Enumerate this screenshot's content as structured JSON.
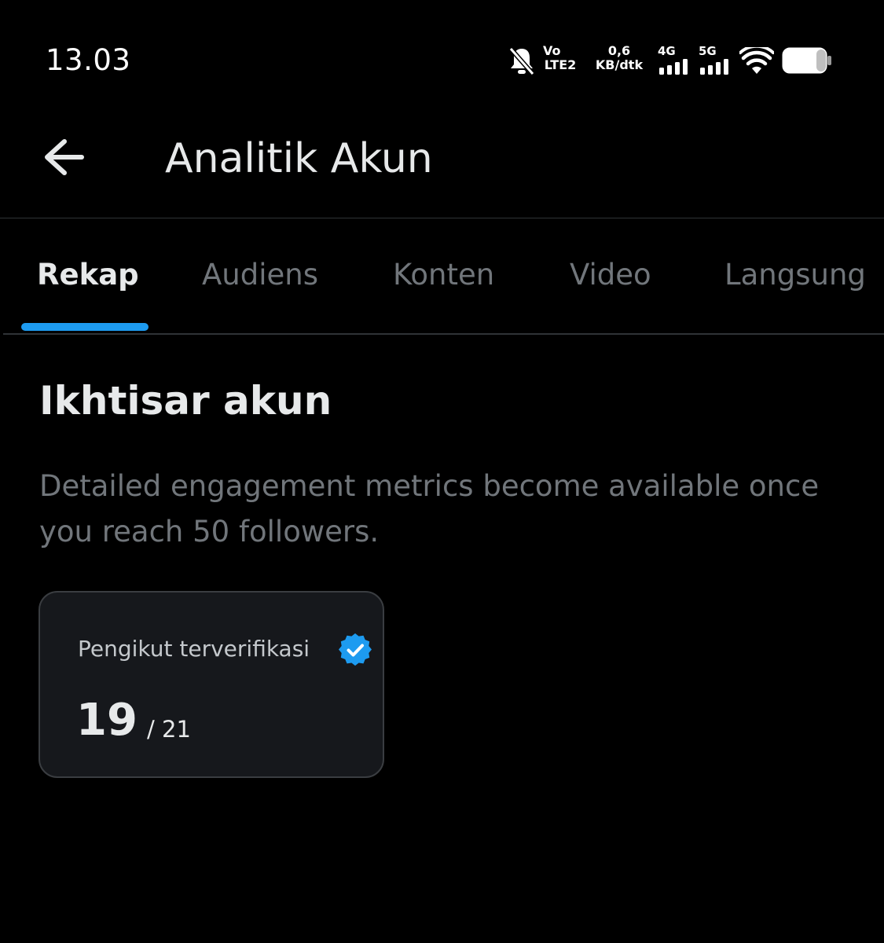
{
  "status_bar": {
    "time": "13.03",
    "volte_top": "Vo",
    "volte_bottom": "LTE2",
    "speed_value": "0,6",
    "speed_unit": "KB/dtk",
    "network_1": "4G",
    "network_2": "5G",
    "icons": [
      "mute-bell-icon",
      "volte-icon",
      "signal-icon",
      "wifi-icon",
      "battery-icon"
    ]
  },
  "header": {
    "title": "Analitik Akun"
  },
  "tabs": [
    {
      "label": "Rekap",
      "active": true
    },
    {
      "label": "Audiens",
      "active": false
    },
    {
      "label": "Konten",
      "active": false
    },
    {
      "label": "Video",
      "active": false
    },
    {
      "label": "Langsung",
      "active": false
    }
  ],
  "overview": {
    "title": "Ikhtisar akun",
    "description": "Detailed engagement metrics become available once you reach 50 followers."
  },
  "stat_card": {
    "label": "Pengikut terverifikasi",
    "value": "19",
    "total": "/ 21"
  },
  "colors": {
    "background": "#000000",
    "accent": "#1d9bf0",
    "primary_text": "#e7e9ea",
    "secondary_text": "#71767b",
    "card_background": "#16181c"
  }
}
